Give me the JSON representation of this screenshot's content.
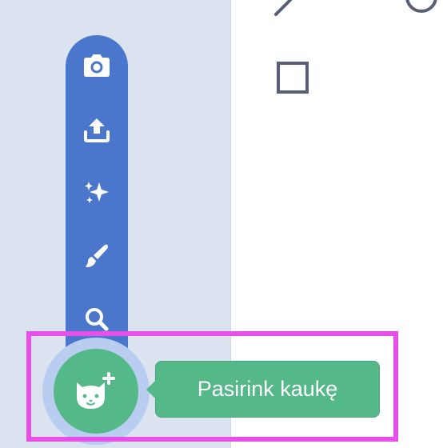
{
  "tooltip": {
    "text": "Pasirink kaukę"
  },
  "menu": {
    "items": [
      {
        "icon": "camera-icon"
      },
      {
        "icon": "upload-icon"
      },
      {
        "icon": "surprise-sparkle-icon"
      },
      {
        "icon": "paint-brush-icon"
      },
      {
        "icon": "search-icon"
      }
    ],
    "main_button_icon": "cat-add-icon"
  },
  "canvas_tools": {
    "icons": [
      "line-tool-icon",
      "circle-tool-icon",
      "rectangle-tool-icon"
    ]
  },
  "colors": {
    "left_panel": "#dbe2f0",
    "menu_blue": "#4a77cc",
    "green": "#55b888",
    "halo": "#b9cdf0",
    "highlight": "#e84fe8",
    "tool_gray": "#575e75"
  }
}
